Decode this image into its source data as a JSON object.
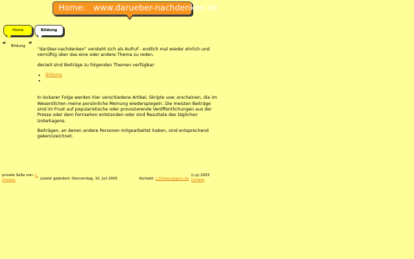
{
  "banner": {
    "label": "Home:",
    "url": "www.darueber-nachdenken.de"
  },
  "tabs": [
    {
      "label": "Home"
    },
    {
      "label": "Bildung"
    }
  ],
  "side": {
    "open_quote": "“",
    "label": "Bildung",
    "close_quote": "”"
  },
  "main": {
    "intro": "“darüber-nachdenken” versteht sich als Aufruf - endlich mal wieder ehrlich und vernüftig über das eine oder andere Thema zu reden.",
    "topics_heading": "derzeit sind Beiträge zu folgenden Themen verfügbar:",
    "topics": [
      "Bildung",
      ""
    ],
    "para2": "In lockerer Folge werden hier verschiedene Artikel, Skripte usw. erscheinen, die im Wesentlichen meine persönliche Meinung wiederspiegeln. Die meisten Beiträge sind im Frust auf popularistische oder provozierende Veröffentlichungen aus der Presse oder dem Fernsehen entstanden oder sind Resultate des täglichen Unbehagens.",
    "para3": "Beiträgen, an denen andere Personen mitgearbeitet haben, sind entsprechend gekennzeichnet."
  },
  "footer": {
    "private_label": "private Seite von:",
    "private_link": "L. Drewes",
    "changed": "zuletzt geändert: Donnerstag, 10. Juli 2003",
    "contact_label": "Kontakt:",
    "contact_link": "L.Drewes@gmx.de",
    "copyright": "(c.p) 2003",
    "copyright_link": "Drewes"
  },
  "colors": {
    "background": "#ffff99",
    "banner": "#f7941d",
    "link": "#e07b00",
    "tab_active": "#ffff00"
  }
}
